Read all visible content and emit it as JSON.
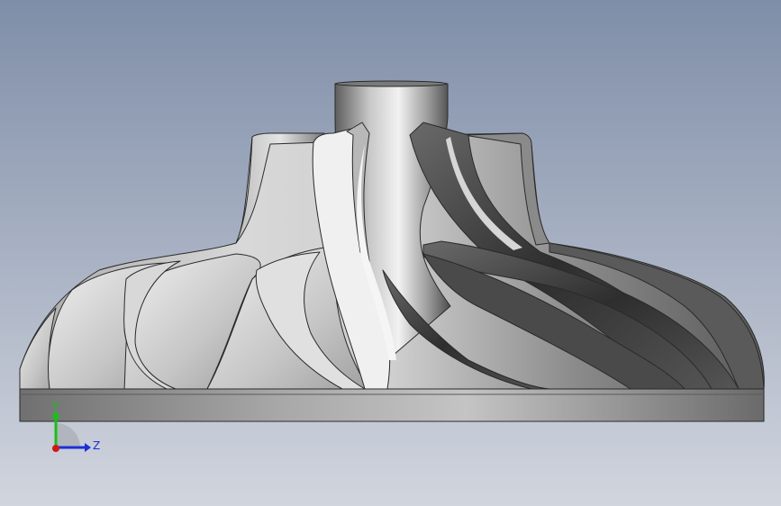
{
  "viewport": {
    "background_top": "#7f8ea8",
    "background_bottom": "#cfd3dc"
  },
  "model": {
    "name": "impeller",
    "base_color": "#9a9a9a",
    "dark_blade": "#3c3c3c",
    "light_blade": "#e8e8e8",
    "edge_color": "#2a2a2a"
  },
  "triad": {
    "y_label": "Y",
    "z_label": "Z",
    "y_color": "#18c018",
    "z_color": "#1a2fd8",
    "x_color": "#d01818"
  }
}
